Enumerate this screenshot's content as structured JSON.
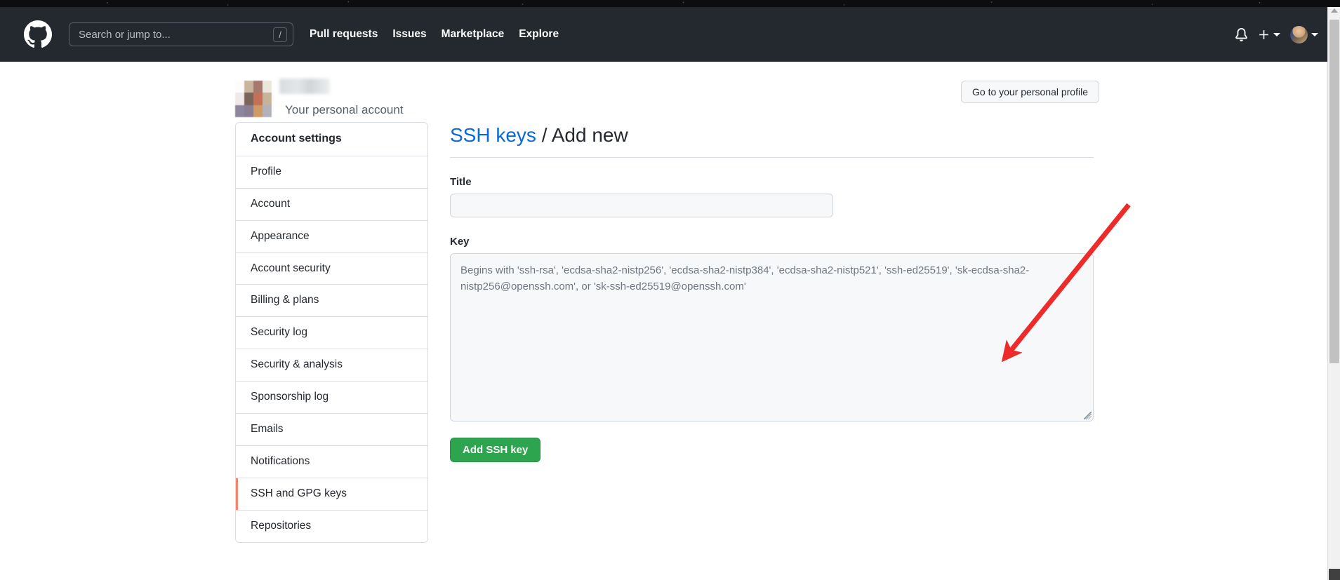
{
  "header": {
    "logo_icon": "github-mark-icon",
    "search": {
      "placeholder": "Search or jump to...",
      "shortcut_badge": "/"
    },
    "nav": [
      {
        "label": "Pull requests"
      },
      {
        "label": "Issues"
      },
      {
        "label": "Marketplace"
      },
      {
        "label": "Explore"
      }
    ],
    "notifications_icon": "bell-icon",
    "create_new_icon": "plus-icon",
    "create_new_caret_icon": "chevron-down-icon",
    "avatar_icon": "user-avatar",
    "avatar_caret_icon": "chevron-down-icon",
    "background_color": "#24292f"
  },
  "account": {
    "avatar_label": "pixelated-avatar",
    "username_redacted": "",
    "subtitle": "Your personal account",
    "profile_button": "Go to your personal profile"
  },
  "sidebar": {
    "heading": "Account settings",
    "items": [
      {
        "label": "Profile",
        "active": false
      },
      {
        "label": "Account",
        "active": false
      },
      {
        "label": "Appearance",
        "active": false
      },
      {
        "label": "Account security",
        "active": false
      },
      {
        "label": "Billing & plans",
        "active": false
      },
      {
        "label": "Security log",
        "active": false
      },
      {
        "label": "Security & analysis",
        "active": false
      },
      {
        "label": "Sponsorship log",
        "active": false
      },
      {
        "label": "Emails",
        "active": false
      },
      {
        "label": "Notifications",
        "active": false
      },
      {
        "label": "SSH and GPG keys",
        "active": true
      },
      {
        "label": "Repositories",
        "active": false
      }
    ],
    "active_accent_color": "#f9826c"
  },
  "main": {
    "title_link": "SSH keys",
    "title_separator": "/",
    "title_current": "Add new",
    "title_link_color": "#0969da",
    "fields": {
      "title_label": "Title",
      "title_value": "",
      "title_placeholder": "",
      "key_label": "Key",
      "key_value": "",
      "key_placeholder": "Begins with 'ssh-rsa', 'ecdsa-sha2-nistp256', 'ecdsa-sha2-nistp384', 'ecdsa-sha2-nistp521', 'ssh-ed25519', 'sk-ecdsa-sha2-nistp256@openssh.com', or 'sk-ssh-ed25519@openssh.com'"
    },
    "submit_button": "Add SSH key",
    "submit_button_color": "#2da44e"
  },
  "annotation": {
    "arrow_color": "#ee2b2b",
    "arrow_from": "1608,292",
    "arrow_to": "1432,508"
  },
  "scrollbar": {
    "thumb_color": "#c1c1c1",
    "track_color": "#f1f1f1"
  }
}
